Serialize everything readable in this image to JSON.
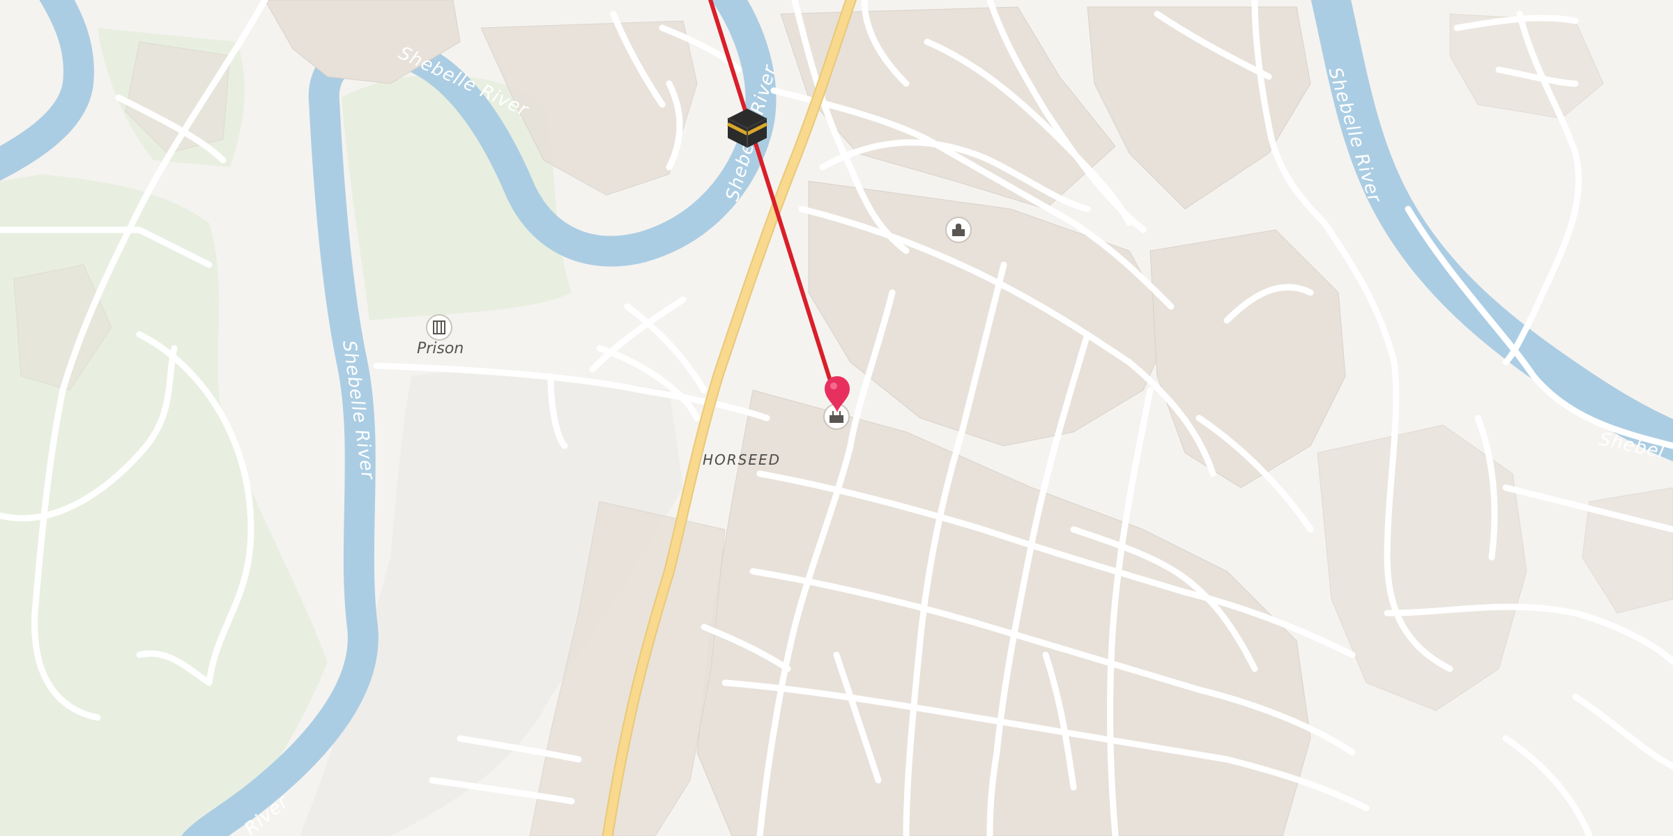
{
  "map": {
    "river_name": "Shebelle River",
    "river_fragment_tr": "Shebel",
    "river_fragment_bl": "River",
    "neighborhood": "HORSEED",
    "poi_prison": "Prison",
    "icons": [
      "kaaba-icon",
      "location-pin-icon",
      "mosque-icon",
      "prison-icon",
      "monument-icon"
    ],
    "colors": {
      "background": "#f5f3f0",
      "water": "#abcde3",
      "park": "#e8efe0",
      "building": "#e7e1d9",
      "road": "#ffffff",
      "primary_road": "#f8d98e",
      "route": "#d81f2a",
      "pin": "#e8305e"
    }
  }
}
